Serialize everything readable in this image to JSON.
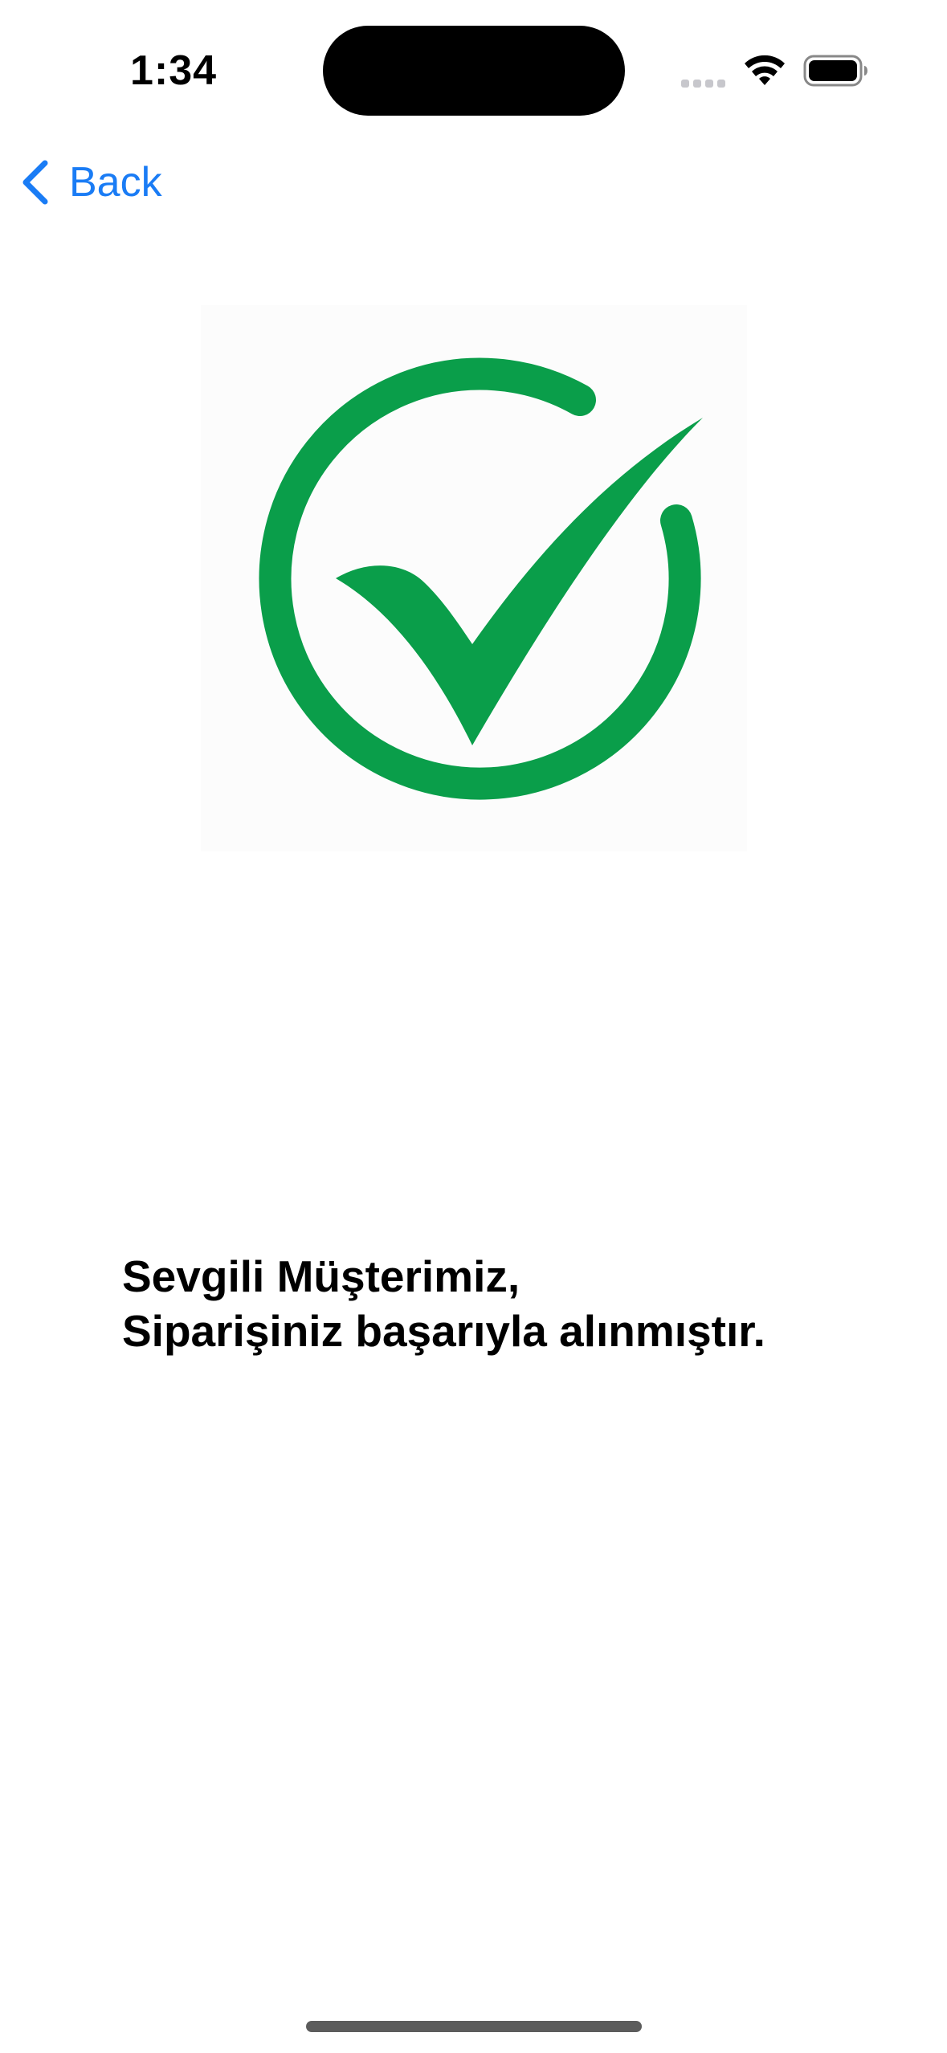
{
  "status_bar": {
    "time": "1:34"
  },
  "nav": {
    "back_label": "Back"
  },
  "message": {
    "line1": "Sevgili Müşterimiz,",
    "line2": "Siparişiniz başarıyla alınmıştır."
  },
  "colors": {
    "accent": "#1a7cf5",
    "success_green": "#0a9e4a"
  },
  "icons": [
    "wifi-icon",
    "battery-icon",
    "cellular-signal-icon",
    "chevron-left-icon",
    "check-circle-icon"
  ]
}
